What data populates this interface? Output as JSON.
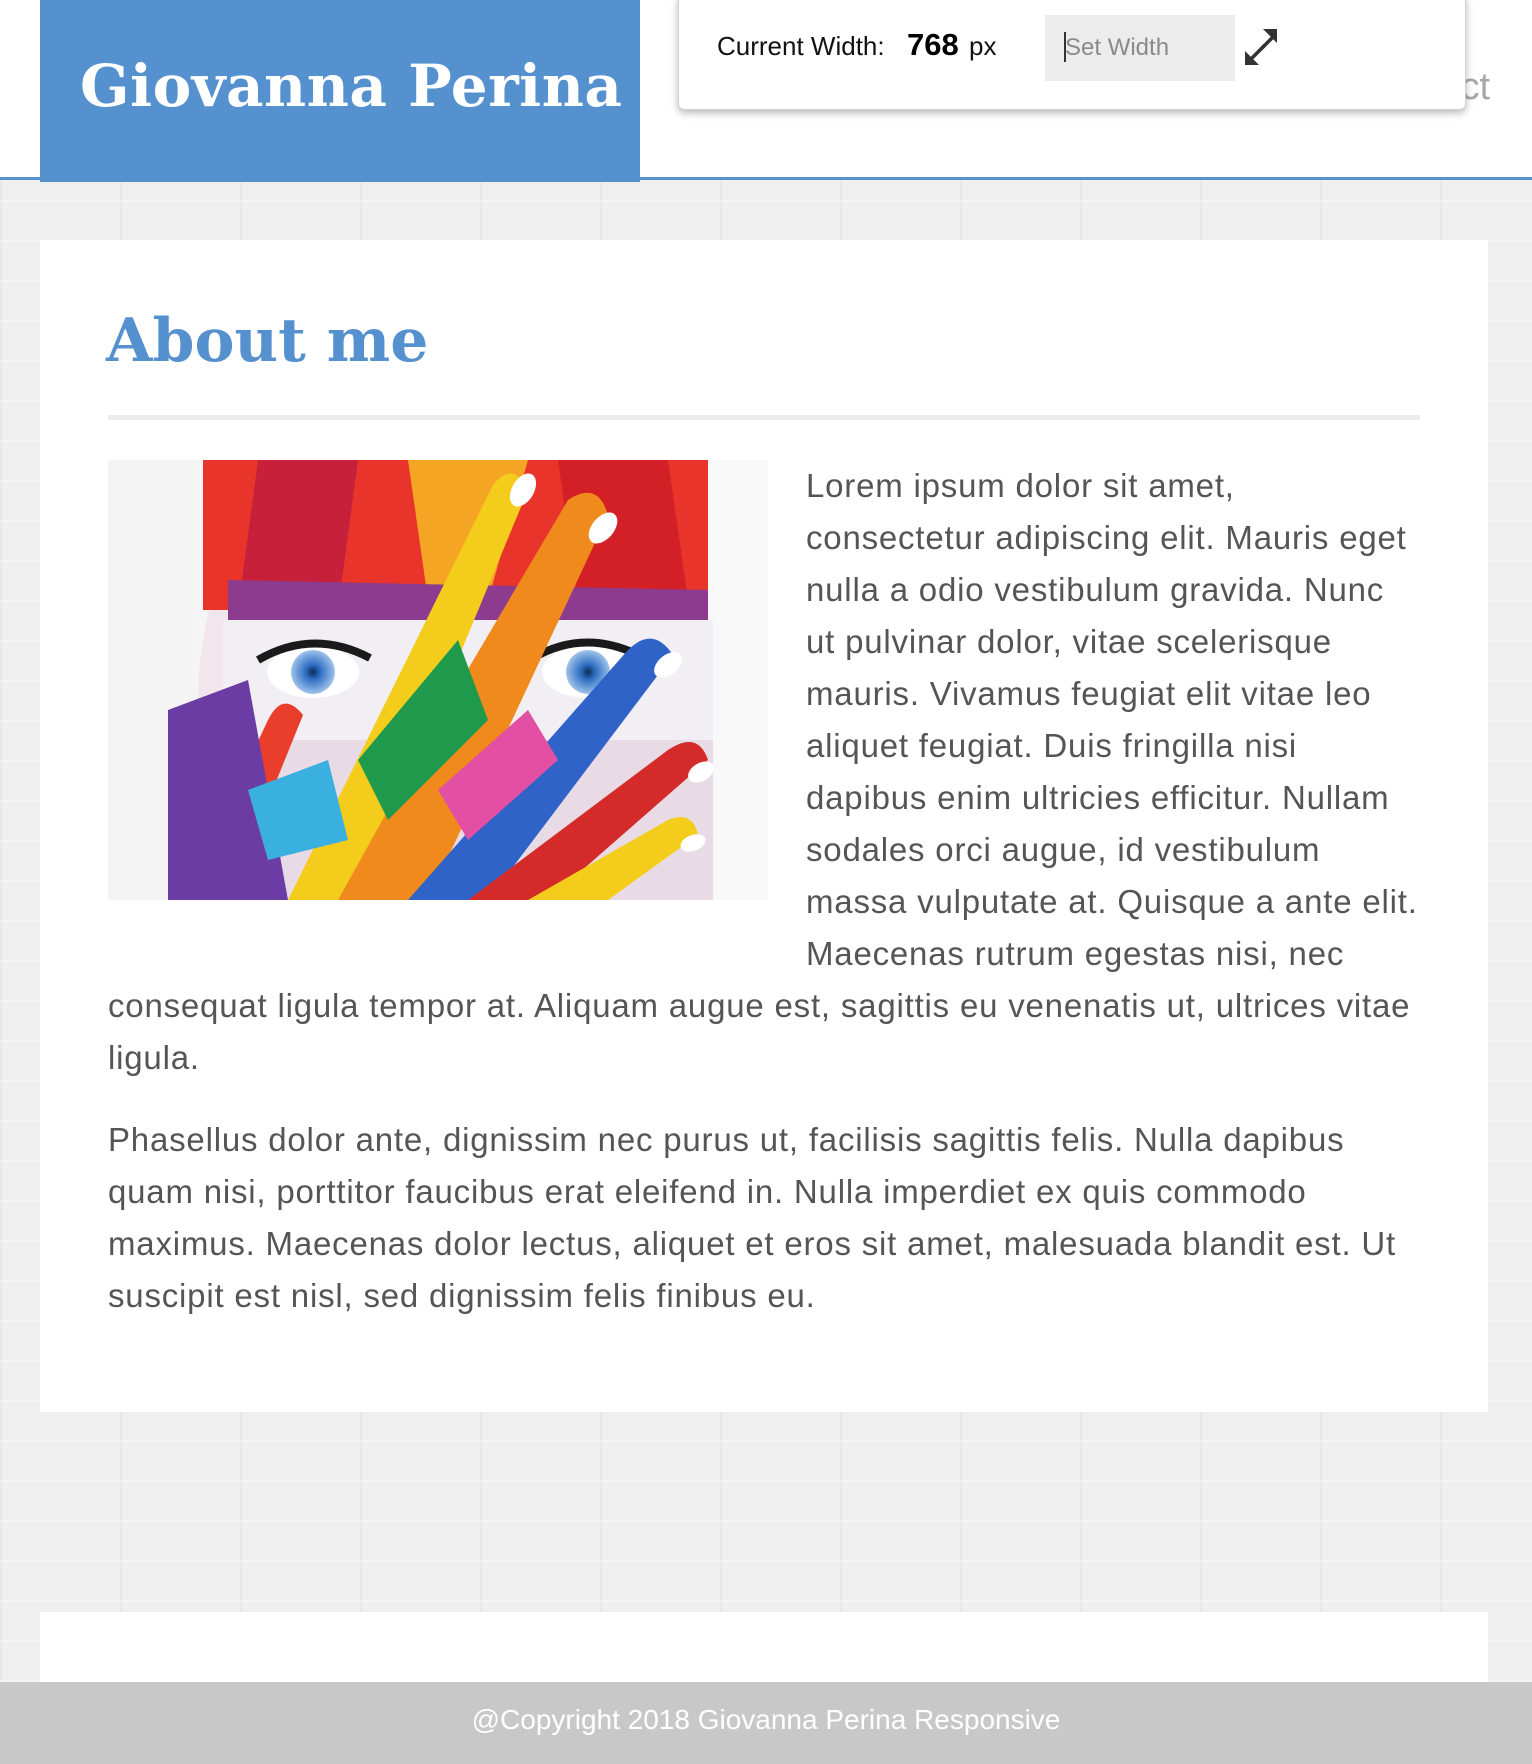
{
  "header": {
    "brand_title": "Giovanna Perina",
    "nav_partial_label": "ct",
    "brand_color": "#5591cf"
  },
  "width_toolbar": {
    "label": "Current Width:",
    "value": "768",
    "unit": "px",
    "input_placeholder": "Set Width",
    "input_value": "",
    "expand_icon": "expand-arrows-icon"
  },
  "about": {
    "title": "About me",
    "paragraph_1": "Lorem ipsum dolor sit amet, consectetur adipiscing elit. Mauris eget nulla a odio vestibulum gravida. Nunc ut pulvinar dolor, vitae scelerisque mauris. Vivamus feugiat elit vitae leo aliquet feugiat. Duis fringilla nisi dapibus enim ultricies efficitur. Nullam sodales orci augue, id vestibulum massa vulputate at. Quisque a ante elit. Maecenas rutrum egestas nisi, nec consequat ligula tempor at. Aliquam augue est, sagittis eu venenatis ut, ultrices vitae ligula.",
    "paragraph_2": "Phasellus dolor ante, dignissim nec purus ut, facilisis sagittis felis. Nulla dapibus quam nisi, porttitor faucibus erat eleifend in. Nulla imperdiet ex quis commodo maximus. Maecenas dolor lectus, aliquet et eros sit amet, malesuada blandit est. Ut suscipit est nisl, sed dignissim felis finibus eu."
  },
  "footer": {
    "copyright": "@Copyright 2018 Giovanna Perina Responsive"
  }
}
